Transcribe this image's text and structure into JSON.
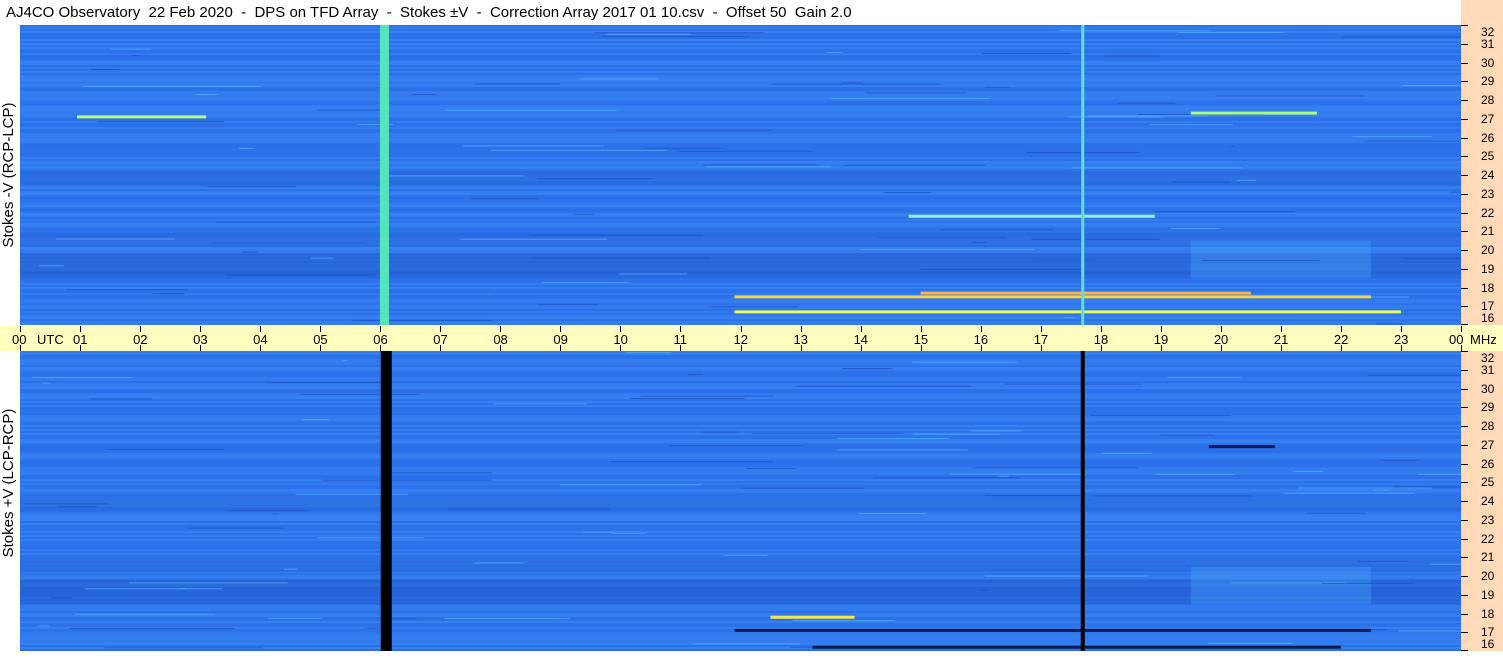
{
  "title": "AJ4CO Observatory  22 Feb 2020  -  DPS on TFD Array  -  Stokes ±V  -  Correction Array 2017 01 10.csv  -  Offset 50  Gain 2.0",
  "colors": {
    "background": "#2f76ee",
    "axis_time_bg": "#ffffc0",
    "axis_freq_bg": "#ffd9b8"
  },
  "chart_data": [
    {
      "type": "heatmap",
      "ylabel": "Stokes -V (RCP-LCP)",
      "x_unit": "UTC",
      "y_unit": "MHz",
      "x_range": [
        0,
        24
      ],
      "y_range": [
        16,
        32
      ],
      "x_ticks": [
        "00",
        "01",
        "02",
        "03",
        "04",
        "05",
        "06",
        "07",
        "08",
        "09",
        "10",
        "11",
        "12",
        "13",
        "14",
        "15",
        "16",
        "17",
        "18",
        "19",
        "20",
        "21",
        "22",
        "23",
        "00"
      ],
      "y_ticks": [
        "32",
        "31",
        "30",
        "29",
        "28",
        "27",
        "26",
        "25",
        "24",
        "23",
        "22",
        "21",
        "20",
        "19",
        "18",
        "17",
        "16"
      ],
      "vertical_features": [
        {
          "time_utc": 6.07,
          "kind": "bright",
          "color": "#55e6b8"
        },
        {
          "time_utc": 17.7,
          "kind": "bright",
          "color": "#5ee0e0"
        }
      ],
      "emission_streaks": [
        {
          "t0": 0.95,
          "t1": 3.1,
          "freq": 27.1,
          "color": "#b9ff7a"
        },
        {
          "t0": 11.9,
          "t1": 23.0,
          "freq": 16.7,
          "color": "#e6ff5a"
        },
        {
          "t0": 11.9,
          "t1": 22.5,
          "freq": 17.5,
          "color": "#f2d54a"
        },
        {
          "t0": 15.0,
          "t1": 20.5,
          "freq": 17.7,
          "color": "#ffb347"
        },
        {
          "t0": 19.5,
          "t1": 21.6,
          "freq": 27.3,
          "color": "#a9ff86"
        },
        {
          "t0": 14.8,
          "t1": 18.9,
          "freq": 21.8,
          "color": "#8ff5d7"
        }
      ]
    },
    {
      "type": "heatmap",
      "ylabel": "Stokes +V (LCP-RCP)",
      "x_unit": "UTC",
      "y_unit": "MHz",
      "x_range": [
        0,
        24
      ],
      "y_range": [
        16,
        32
      ],
      "x_ticks": [
        "00",
        "01",
        "02",
        "03",
        "04",
        "05",
        "06",
        "07",
        "08",
        "09",
        "10",
        "11",
        "12",
        "13",
        "14",
        "15",
        "16",
        "17",
        "18",
        "19",
        "20",
        "21",
        "22",
        "23",
        "00"
      ],
      "y_ticks": [
        "32",
        "31",
        "30",
        "29",
        "28",
        "27",
        "26",
        "25",
        "24",
        "23",
        "22",
        "21",
        "20",
        "19",
        "18",
        "17",
        "16"
      ],
      "vertical_features": [
        {
          "time_utc": 6.1,
          "kind": "dark",
          "color": "#000000"
        },
        {
          "time_utc": 17.7,
          "kind": "dark",
          "color": "#000000"
        }
      ],
      "emission_streaks": [
        {
          "t0": 12.5,
          "t1": 13.9,
          "freq": 17.8,
          "color": "#f5e94a"
        },
        {
          "t0": 11.9,
          "t1": 22.5,
          "freq": 17.1,
          "color": "#0a1a55"
        },
        {
          "t0": 13.2,
          "t1": 22.0,
          "freq": 16.2,
          "color": "#0a1a55"
        },
        {
          "t0": 19.8,
          "t1": 20.9,
          "freq": 26.9,
          "color": "#0a1a55"
        }
      ]
    }
  ],
  "axis": {
    "time_first_label": "00",
    "time_unit_label": "UTC",
    "time_last_label": "00",
    "freq_unit_label": "MHz"
  }
}
